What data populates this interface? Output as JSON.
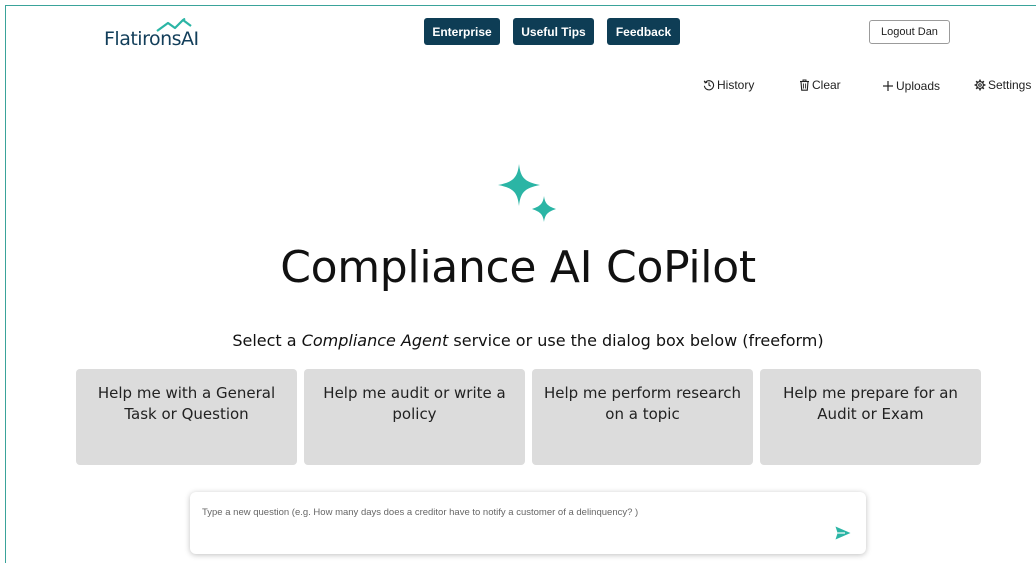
{
  "logo": {
    "text": "FlatironsAI"
  },
  "nav": {
    "enterprise": "Enterprise",
    "useful_tips": "Useful Tips",
    "feedback": "Feedback",
    "logout": "Logout Dan"
  },
  "toolbar": {
    "history": "History",
    "clear": "Clear",
    "uploads": "Uploads",
    "settings": "Settings"
  },
  "main": {
    "title": "Compliance AI CoPilot",
    "subtitle_before": "Select a ",
    "subtitle_em": "Compliance Agent",
    "subtitle_after": " service or use the dialog box below (freeform)"
  },
  "cards": [
    {
      "label": "Help me with a General Task or Question"
    },
    {
      "label": "Help me audit or write a policy"
    },
    {
      "label": "Help me perform research on a topic"
    },
    {
      "label": "Help me prepare for an Audit or Exam"
    }
  ],
  "question": {
    "placeholder": "Type a new question (e.g. How many days does a creditor have to notify a customer of a delinquency? )",
    "value": ""
  },
  "colors": {
    "brand_navy": "#0e3d55",
    "accent_teal": "#2bb5a5",
    "card_bg": "#dcdcdc"
  },
  "icons": {
    "history": "history-icon",
    "clear": "trash-icon",
    "uploads": "plus-icon",
    "settings": "gear-icon",
    "send": "send-icon",
    "hero": "sparkle-icon"
  }
}
